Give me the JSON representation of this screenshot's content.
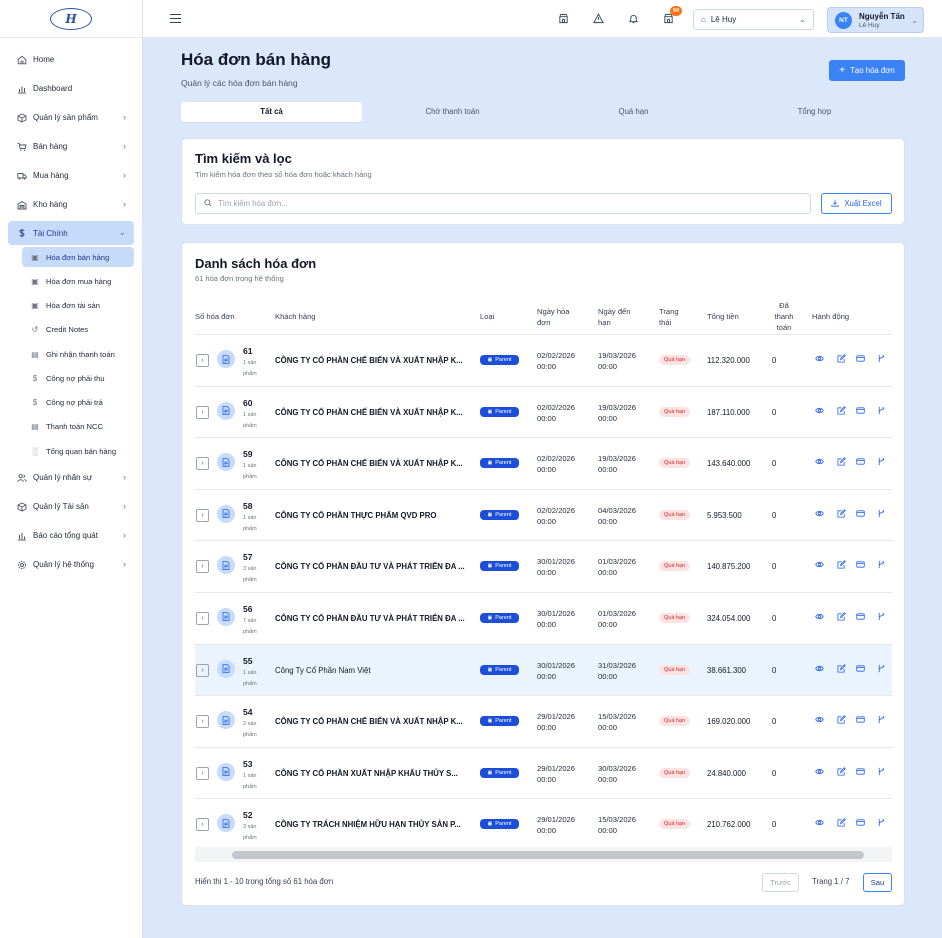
{
  "topbar": {
    "badge": "94",
    "branch": "Lê Huy",
    "user_initials": "NT",
    "user_name": "Nguyễn Tấn",
    "user_branch": "Lê Huy"
  },
  "sidebar": {
    "items": [
      {
        "label": "Home",
        "icon": "home-icon"
      },
      {
        "label": "Dashboard",
        "icon": "chart-icon"
      },
      {
        "label": "Quản lý sản phẩm",
        "icon": "box-icon",
        "chevron": true
      },
      {
        "label": "Bán hàng",
        "icon": "cart-icon",
        "chevron": true
      },
      {
        "label": "Mua hàng",
        "icon": "truck-icon",
        "chevron": true
      },
      {
        "label": "Kho hàng",
        "icon": "warehouse-icon",
        "chevron": true
      },
      {
        "label": "Tài Chính",
        "icon": "dollar-icon",
        "chevron": true,
        "active": true
      }
    ],
    "sub_items": [
      {
        "label": "Hóa đơn bán hàng",
        "active": true
      },
      {
        "label": "Hóa đơn mua hàng"
      },
      {
        "label": "Hóa đơn tài sản"
      },
      {
        "label": "Credit Notes"
      },
      {
        "label": "Ghi nhận thanh toán"
      },
      {
        "label": "Công nợ phải thu"
      },
      {
        "label": "Công nợ phải trả"
      },
      {
        "label": "Thanh toán NCC"
      },
      {
        "label": "Tổng quan bán hàng"
      }
    ],
    "items_after": [
      {
        "label": "Quản lý nhân sự",
        "icon": "users-icon",
        "chevron": true
      },
      {
        "label": "Quản lý Tài sản",
        "icon": "asset-icon",
        "chevron": true
      },
      {
        "label": "Báo cáo tổng quát",
        "icon": "report-icon",
        "chevron": true
      },
      {
        "label": "Quản lý hệ thống",
        "icon": "gear-icon",
        "chevron": true
      }
    ]
  },
  "page": {
    "title": "Hóa đơn bán hàng",
    "subtitle": "Quản lý các hóa đơn bán hàng",
    "create_label": "Tạo hóa đơn",
    "tabs": [
      "Tất cả",
      "Chờ thanh toán",
      "Quá hạn",
      "Tổng hợp"
    ]
  },
  "search": {
    "title": "Tìm kiếm và lọc",
    "subtitle": "Tìm kiếm hóa đơn theo số hóa đơn hoặc khách hàng",
    "placeholder": "Tìm kiếm hóa đơn...",
    "export_label": "Xuất Excel"
  },
  "list": {
    "title": "Danh sách hóa đơn",
    "subtitle": "61 hóa đơn trong hệ thống",
    "columns": {
      "number": "Số hóa đơn",
      "customer": "Khách hàng",
      "type": "Loại",
      "issue_date": "Ngày hóa đơn",
      "due_date": "Ngày đến hạn",
      "status": "Trạng thái",
      "total": "Tổng tiền",
      "paid": "Đã thanh toán",
      "actions": "Hành động"
    },
    "rows": [
      {
        "no": "61",
        "items": "1 sản phẩm",
        "customer": "CÔNG TY CỔ PHẦN CHẾ BIẾN VÀ XUẤT NHẬP K...",
        "type": "Parent",
        "issue": "02/02/2026",
        "issue_time": "00:00",
        "due": "19/03/2026",
        "due_time": "00:00",
        "status": "Quá hạn",
        "total": "112.320.000",
        "paid": "0"
      },
      {
        "no": "60",
        "items": "1 sản phẩm",
        "customer": "CÔNG TY CỔ PHẦN CHẾ BIẾN VÀ XUẤT NHẬP K...",
        "type": "Parent",
        "issue": "02/02/2026",
        "issue_time": "00:00",
        "due": "19/03/2026",
        "due_time": "00:00",
        "status": "Quá hạn",
        "total": "187.110.000",
        "paid": "0"
      },
      {
        "no": "59",
        "items": "1 sản phẩm",
        "customer": "CÔNG TY CỔ PHẦN CHẾ BIẾN VÀ XUẤT NHẬP K...",
        "type": "Parent",
        "issue": "02/02/2026",
        "issue_time": "00:00",
        "due": "19/03/2026",
        "due_time": "00:00",
        "status": "Quá hạn",
        "total": "143.640.000",
        "paid": "0"
      },
      {
        "no": "58",
        "items": "1 sản phẩm",
        "customer": "CÔNG TY CỔ PHẦN THỰC PHẨM QVD PRO",
        "type": "Parent",
        "issue": "02/02/2026",
        "issue_time": "00:00",
        "due": "04/03/2026",
        "due_time": "00:00",
        "status": "Quá hạn",
        "total": "5.953.500",
        "paid": "0"
      },
      {
        "no": "57",
        "items": "3 sản phẩm",
        "customer": "CÔNG TY CỔ PHẦN ĐẦU TƯ VÀ PHÁT TRIỂN ĐA ...",
        "type": "Parent",
        "issue": "30/01/2026",
        "issue_time": "00:00",
        "due": "01/03/2026",
        "due_time": "00:00",
        "status": "Quá hạn",
        "total": "140.875.200",
        "paid": "0"
      },
      {
        "no": "56",
        "items": "7 sản phẩm",
        "customer": "CÔNG TY CỔ PHẦN ĐẦU TƯ VÀ PHÁT TRIỂN ĐA ...",
        "type": "Parent",
        "issue": "30/01/2026",
        "issue_time": "00:00",
        "due": "01/03/2026",
        "due_time": "00:00",
        "status": "Quá hạn",
        "total": "324.054.000",
        "paid": "0"
      },
      {
        "no": "55",
        "items": "1 sản phẩm",
        "customer": "Công Ty Cổ Phần Nam Việt",
        "type": "Parent",
        "issue": "30/01/2026",
        "issue_time": "00:00",
        "due": "31/03/2026",
        "due_time": "00:00",
        "status": "Quá hạn",
        "total": "38.661.300",
        "paid": "0",
        "highlight": true,
        "plain": true
      },
      {
        "no": "54",
        "items": "2 sản phẩm",
        "customer": "CÔNG TY CỔ PHẦN CHẾ BIẾN VÀ XUẤT NHẬP K...",
        "type": "Parent",
        "issue": "29/01/2026",
        "issue_time": "00:00",
        "due": "15/03/2026",
        "due_time": "00:00",
        "status": "Quá hạn",
        "total": "169.020.000",
        "paid": "0"
      },
      {
        "no": "53",
        "items": "1 sản phẩm",
        "customer": "CÔNG TY CỔ PHẦN XUẤT NHẬP KHẨU THỦY S...",
        "type": "Parent",
        "issue": "29/01/2026",
        "issue_time": "00:00",
        "due": "30/03/2026",
        "due_time": "00:00",
        "status": "Quá hạn",
        "total": "24.840.000",
        "paid": "0"
      },
      {
        "no": "52",
        "items": "3 sản phẩm",
        "customer": "CÔNG TY TRÁCH NHIỆM HỮU HẠN THỦY SẢN P...",
        "type": "Parent",
        "issue": "29/01/2026",
        "issue_time": "00:00",
        "due": "15/03/2026",
        "due_time": "00:00",
        "status": "Quá hạn",
        "total": "210.762.000",
        "paid": "0"
      }
    ],
    "footer_text": "Hiển thị 1 - 10 trong tổng số 61 hóa đơn",
    "prev_label": "Trước",
    "page_indicator": "Trang 1 / 7",
    "next_label": "Sau"
  },
  "colors": {
    "accent": "#3b82f6",
    "active_bg": "#c6dafa",
    "status_bg": "#fde2e2",
    "status_fg": "#dc2626",
    "badge": "#f97316"
  }
}
